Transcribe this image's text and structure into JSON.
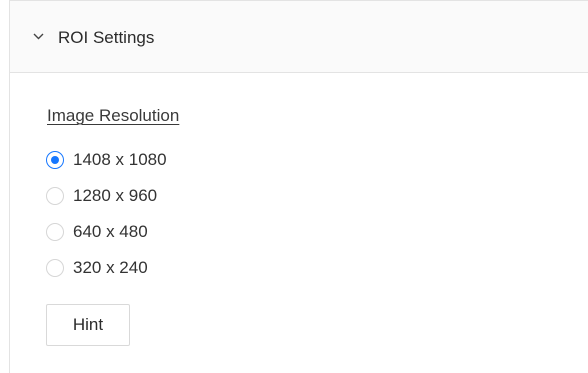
{
  "panel": {
    "title": "ROI Settings",
    "expanded": true,
    "chevron_icon": "chevron-down-icon"
  },
  "resolution": {
    "label": "Image Resolution",
    "selected": "1408 x 1080",
    "options": [
      "1408 x 1080",
      "1280 x 960",
      "640 x 480",
      "320 x 240"
    ]
  },
  "actions": {
    "hint_label": "Hint"
  },
  "colors": {
    "accent": "#1677ff",
    "border": "#e3e3e3",
    "header_bg": "#fafafa"
  }
}
